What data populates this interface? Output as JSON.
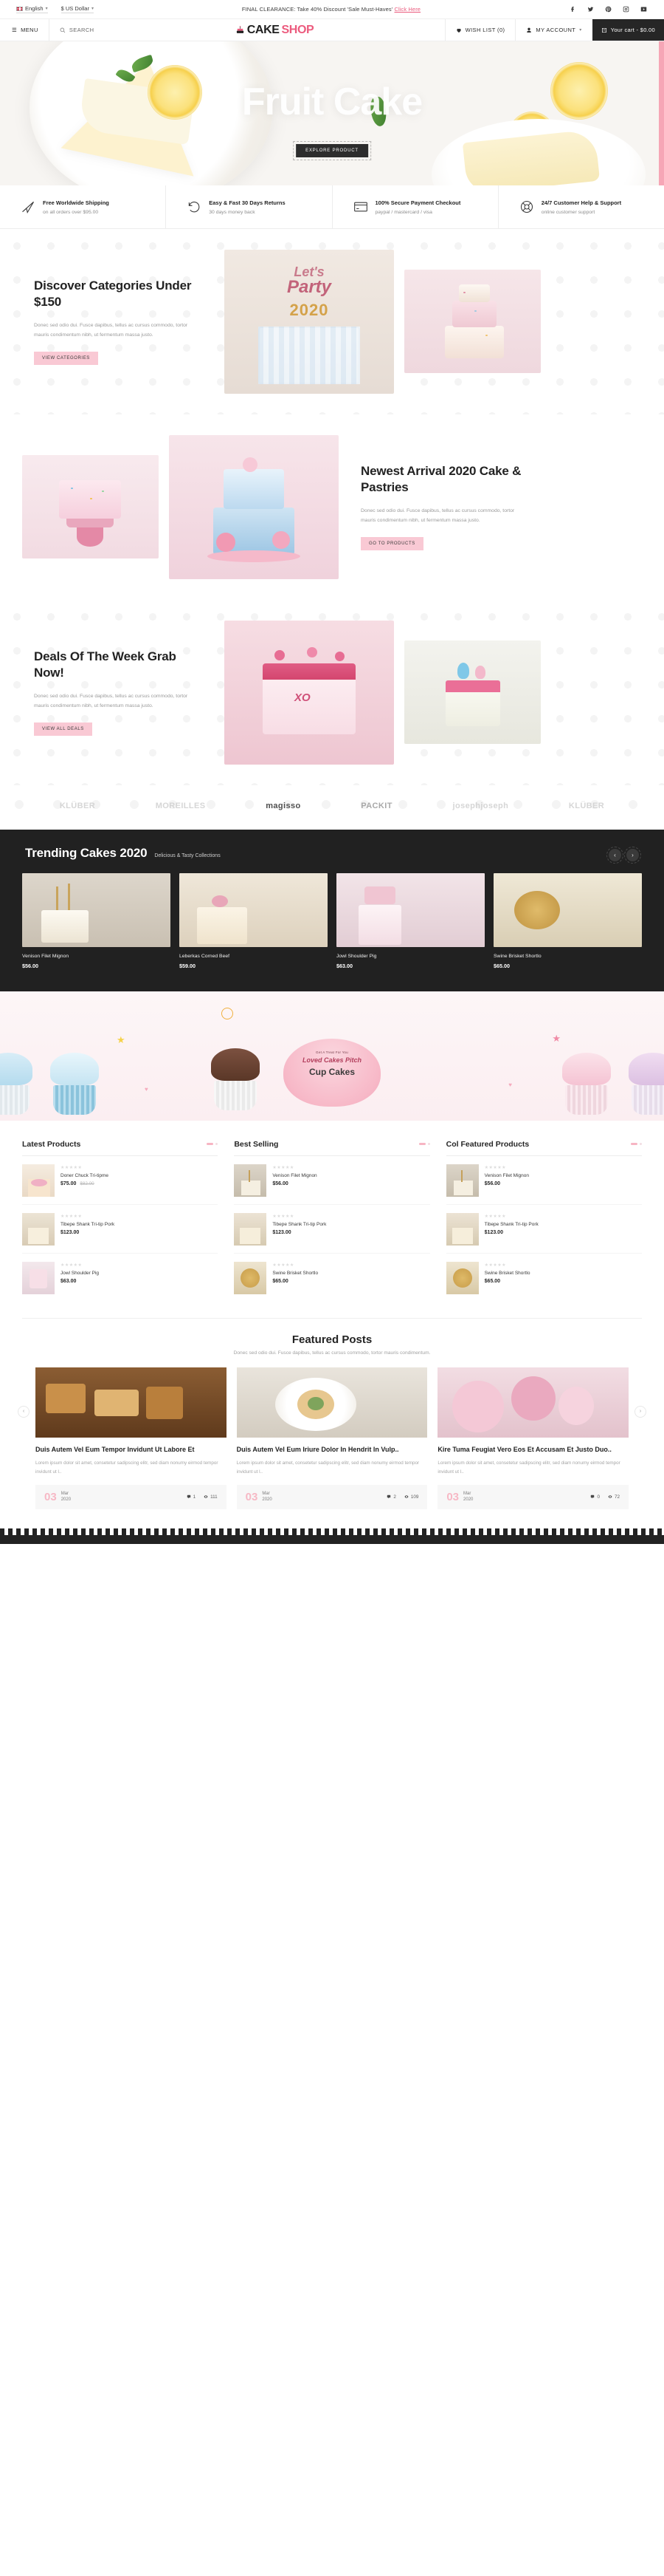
{
  "topbar": {
    "language": "English",
    "currency": "$ US Dollar",
    "promo_text": "FINAL CLEARANCE: Take 40% Discount 'Sale Must-Haves'",
    "promo_link": "Click Here",
    "socials": [
      "facebook-icon",
      "twitter-icon",
      "pinterest-icon",
      "instagram-icon",
      "youtube-icon"
    ]
  },
  "nav": {
    "menu_label": "MENU",
    "search_label": "SEARCH",
    "logo_primary": "CAKE",
    "logo_accent": "SHOP",
    "wishlist_label": "WISH LIST (0)",
    "account_label": "MY ACCOUNT",
    "cart_label": "Your cart - $0.00"
  },
  "hero": {
    "title": "Fruit Cake",
    "cta": "EXPLORE PRODUCT"
  },
  "features": [
    {
      "icon": "paper-plane-icon",
      "title": "Free Worldwide Shipping",
      "sub": "on all orders over $95.00"
    },
    {
      "icon": "rotate-left-icon",
      "title": "Easy & Fast 30 Days Returns",
      "sub": "30 days money back"
    },
    {
      "icon": "credit-card-icon",
      "title": "100% Secure Payment Checkout",
      "sub": "paypal / mastercard / visa"
    },
    {
      "icon": "lifebuoy-icon",
      "title": "24/7 Customer Help & Support",
      "sub": "online customer support"
    }
  ],
  "promos": [
    {
      "title": "Discover Categories Under $150",
      "desc": "Donec sed odio dui. Fusce dapibus, tellus ac cursus commodo, tortor mauris condimentum nibh, ut fermentum massa justo.",
      "button": "VIEW CATEGORIES"
    },
    {
      "title": "Newest Arrival 2020 Cake & Pastries",
      "desc": "Donec sed odio dui. Fusce dapibus, tellus ac cursus commodo, tortor mauris condimentum nibh, ut fermentum massa justo.",
      "button": "GO TO PRODUCTS"
    },
    {
      "title": "Deals Of The Week Grab Now!",
      "desc": "Donec sed odio dui. Fusce dapibus, tellus ac cursus commodo, tortor mauris condimentum nibh, ut fermentum massa justo.",
      "button": "VIEW ALL DEALS"
    }
  ],
  "party_sign": {
    "line1": "Let's",
    "line2": "Party",
    "year": "2020"
  },
  "brands": [
    "KLÜBER",
    "MOREILLES",
    "magisso",
    "PACKIT",
    "josephjoseph",
    "KLÜBER"
  ],
  "trending": {
    "title": "Trending Cakes 2020",
    "subtitle": "Delicious & Tasty Collections",
    "prev": "‹",
    "next": "›",
    "products": [
      {
        "name": "Venison Filet Mignon",
        "price": "$56.00"
      },
      {
        "name": "Leberkas Corned Beef",
        "price": "$59.00"
      },
      {
        "name": "Jowl Shoulder Pig",
        "price": "$63.00"
      },
      {
        "name": "Swine Brisket Shortlo",
        "price": "$65.00"
      }
    ]
  },
  "cupcake_banner": {
    "line1": "Get A Treat For You",
    "line2": "Loved Cakes Pitch",
    "line3": "Cup Cakes"
  },
  "product_columns": [
    {
      "title": "Latest Products",
      "items": [
        {
          "name": "Doner Chuck Tri-tipme",
          "price": "$75.00",
          "old_price": "$82.00",
          "rating": 5
        },
        {
          "name": "Tibepe Shank Tri-tip Pork",
          "price": "$123.00",
          "old_price": "",
          "rating": 5
        },
        {
          "name": "Jowl Shoulder Pig",
          "price": "$63.00",
          "old_price": "",
          "rating": 5
        }
      ]
    },
    {
      "title": "Best Selling",
      "items": [
        {
          "name": "Venison Filet Mignon",
          "price": "$56.00",
          "old_price": "",
          "rating": 5
        },
        {
          "name": "Tibepe Shank Tri-tip Pork",
          "price": "$123.00",
          "old_price": "",
          "rating": 5
        },
        {
          "name": "Swine Brisket Shortlo",
          "price": "$65.00",
          "old_price": "",
          "rating": 5
        }
      ]
    },
    {
      "title": "Col Featured Products",
      "items": [
        {
          "name": "Venison Filet Mignon",
          "price": "$56.00",
          "old_price": "",
          "rating": 5
        },
        {
          "name": "Tibepe Shank Tri-tip Pork",
          "price": "$123.00",
          "old_price": "",
          "rating": 5
        },
        {
          "name": "Swine Brisket Shortlo",
          "price": "$65.00",
          "old_price": "",
          "rating": 5
        }
      ]
    }
  ],
  "featured_posts": {
    "title": "Featured Posts",
    "subtitle": "Donec sed odio dui. Fusce dapibus, tellus ac cursus commodo, tortor mauris condimentum.",
    "prev": "‹",
    "next": "›",
    "posts": [
      {
        "title": "Duis Autem Vel Eum Tempor Invidunt Ut Labore Et",
        "excerpt": "Lorem ipsum dolor sit amet, consetetur sadipscing elitr, sed diam nonumy eirmod tempor invidunt ut l..",
        "day": "03",
        "month": "Mar",
        "year": "2020",
        "comments": "1",
        "views": "111"
      },
      {
        "title": "Duis Autem Vel Eum Iriure Dolor In Hendrit In Vulp..",
        "excerpt": "Lorem ipsum dolor sit amet, consetetur sadipscing elitr, sed diam nonumy eirmod tempor invidunt ut l..",
        "day": "03",
        "month": "Mar",
        "year": "2020",
        "comments": "2",
        "views": "109"
      },
      {
        "title": "Kire Tuma Feugiat Vero Eos Et Accusam Et Justo Duo..",
        "excerpt": "Lorem ipsum dolor sit amet, consetetur sadipscing elitr, sed diam nonumy eirmod tempor invidunt ut l..",
        "day": "03",
        "month": "Mar",
        "year": "2020",
        "comments": "0",
        "views": "72"
      }
    ]
  },
  "colors": {
    "accent": "#ec5b7e",
    "pink_soft": "#f9c9d4",
    "dark": "#212121"
  }
}
